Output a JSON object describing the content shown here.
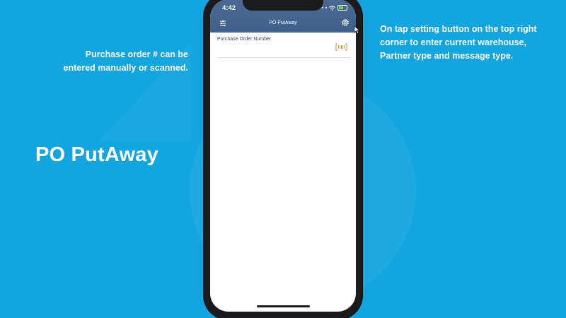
{
  "slide": {
    "title": "PO PutAway",
    "caption_left_line1": "Purchase order # can be",
    "caption_left_line2": "entered manually or scanned.",
    "caption_right_line1": "On tap setting button on the top right",
    "caption_right_line2": "corner to enter current warehouse,",
    "caption_right_line3": "Partner type and message type."
  },
  "status_bar": {
    "time": "4:42"
  },
  "app": {
    "nav_title": "PO PutAway",
    "menu_icon": "menu-icon",
    "settings_icon": "gear-icon"
  },
  "form": {
    "po_label": "Purchase Order Number",
    "po_value": "",
    "scan_icon": "barcode-scan-icon"
  },
  "colors": {
    "background": "#12a5df",
    "header": "#44658d",
    "scan_accent": "#b8893c"
  }
}
